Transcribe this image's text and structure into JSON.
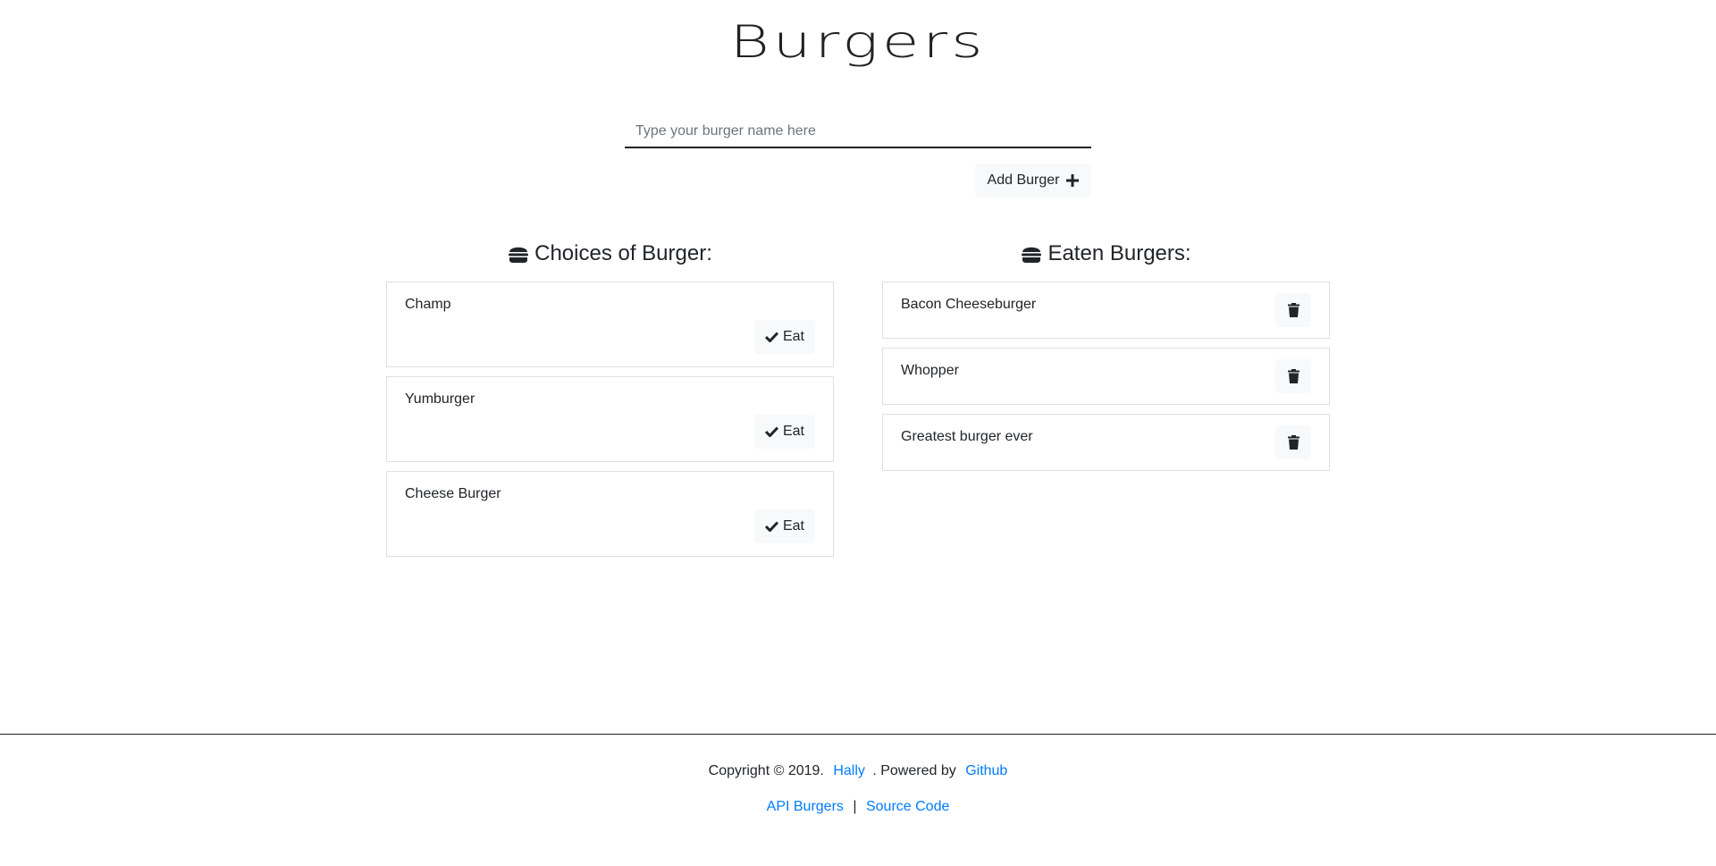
{
  "header": {
    "title": "Burgers"
  },
  "form": {
    "placeholder": "Type your burger name here",
    "value": "",
    "add_label": "Add Burger",
    "add_icon": "plus-icon"
  },
  "choices": {
    "heading": "Choices of Burger:",
    "icon": "hamburger-icon",
    "eat_label": "Eat",
    "items": [
      {
        "name": "Champ"
      },
      {
        "name": "Yumburger"
      },
      {
        "name": "Cheese Burger"
      }
    ]
  },
  "eaten": {
    "heading": "Eaten Burgers:",
    "icon": "hamburger-icon",
    "delete_icon": "trash-icon",
    "items": [
      {
        "name": "Bacon Cheeseburger"
      },
      {
        "name": "Whopper"
      },
      {
        "name": "Greatest burger ever"
      }
    ]
  },
  "footer": {
    "copyright": "Copyright © 2019.",
    "author": "Hally",
    "powered_text": ". Powered by",
    "powered_link": "Github",
    "api_link": "API Burgers",
    "separator": "|",
    "source_link": "Source Code"
  },
  "colors": {
    "link": "#007bff",
    "button_bg": "#f8f9fa",
    "text": "#212529"
  }
}
